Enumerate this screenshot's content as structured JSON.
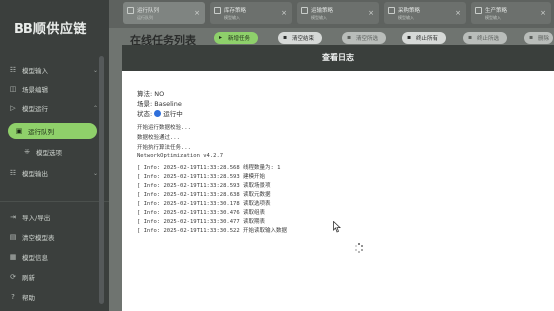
{
  "sidebar": {
    "brand_mark": "BB",
    "brand_text": "顺供应链",
    "items": [
      {
        "label": "模型输入",
        "icon": "list-icon"
      },
      {
        "label": "场景编辑",
        "icon": "layers-icon"
      },
      {
        "label": "模型运行",
        "icon": "play-icon"
      },
      {
        "label": "运行队列",
        "icon": "queue-icon"
      },
      {
        "label": "模型选项",
        "icon": "options-icon"
      },
      {
        "label": "模型输出",
        "icon": "list-icon"
      }
    ],
    "bottom_items": [
      {
        "label": "导入/导出",
        "icon": "import-icon"
      },
      {
        "label": "清空模型表",
        "icon": "trash-icon"
      },
      {
        "label": "模型信息",
        "icon": "info-icon"
      },
      {
        "label": "刷新",
        "icon": "refresh-icon"
      },
      {
        "label": "帮助",
        "icon": "help-icon"
      }
    ]
  },
  "tabs": [
    {
      "label": "运行队列",
      "sub": "运行队列"
    },
    {
      "label": "库存策略",
      "sub": "模型输入"
    },
    {
      "label": "运输策略",
      "sub": "模型输入"
    },
    {
      "label": "采购策略",
      "sub": "模型输入"
    },
    {
      "label": "生产策略",
      "sub": "模型输入"
    }
  ],
  "page": {
    "title": "在线任务列表",
    "buttons": [
      "新增任务",
      "清空结束",
      "清空所选",
      "终止所有",
      "终止所选",
      "删除"
    ]
  },
  "modal": {
    "title": "查看日志",
    "algorithm": "算法: NO",
    "scenario": "场景: Baseline",
    "status_label": "状态:",
    "status_value": "运行中",
    "log_lines": [
      "开始运行数据校验...",
      "数据校验通过...",
      "开始执行算法任务...",
      "NetworkOptimization v4.2.7",
      "[ Info: 2025-02-19T11:33:28.568 线程数量为: 1",
      "[ Info: 2025-02-19T11:33:28.593 建模开始",
      "[ Info: 2025-02-19T11:33:28.593 读取场景项",
      "[ Info: 2025-02-19T11:33:28.638 读取元数据",
      "[ Info: 2025-02-19T11:33:30.178 读取选项表",
      "[ Info: 2025-02-19T11:33:30.476 读取组表",
      "[ Info: 2025-02-19T11:33:30.477 读取期表",
      "[ Info: 2025-02-19T11:33:30.522 开始读取输入数据"
    ]
  },
  "colors": {
    "accent_green": "#8fd06a",
    "sidebar_bg": "#3b3f3d",
    "modal_header": "#3a3f3c",
    "status_blue": "#2f6fdb"
  }
}
